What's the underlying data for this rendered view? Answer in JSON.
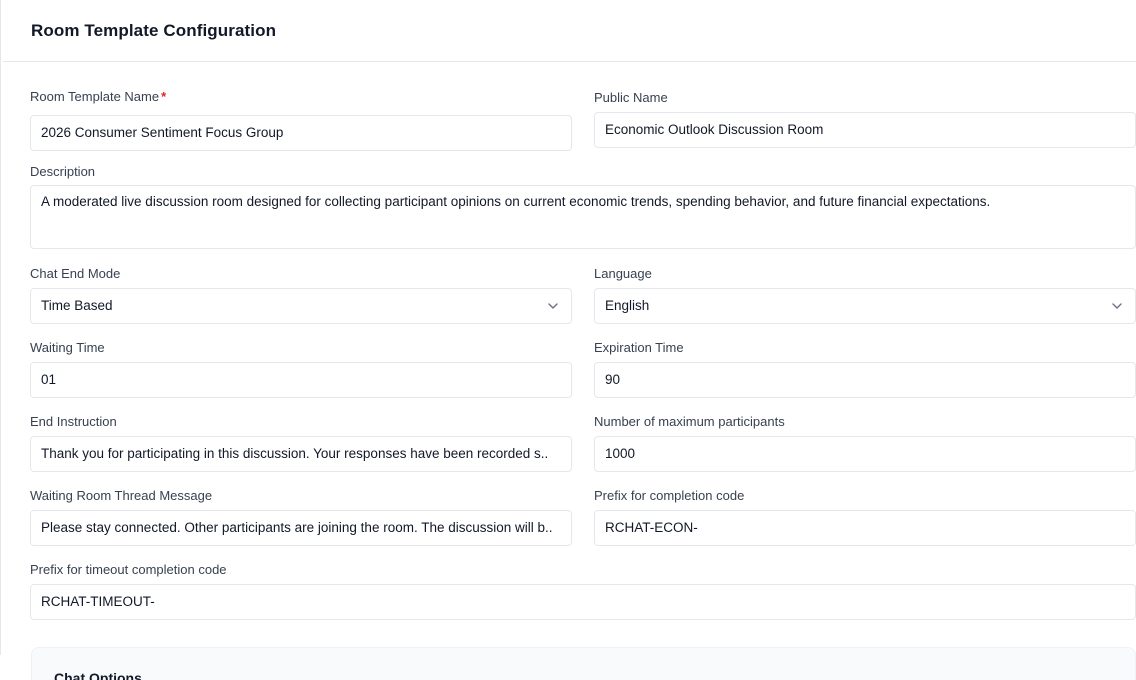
{
  "header": {
    "title": "Room Template Configuration"
  },
  "form": {
    "room_template_name": {
      "label": "Room Template Name",
      "required_mark": "*",
      "value": "2026 Consumer Sentiment Focus Group"
    },
    "public_name": {
      "label": "Public Name",
      "value": "Economic Outlook Discussion Room"
    },
    "description": {
      "label": "Description",
      "value": "A moderated live discussion room designed for collecting participant opinions on current economic trends, spending behavior, and future financial expectations."
    },
    "chat_end_mode": {
      "label": "Chat End Mode",
      "value": "Time Based",
      "icon": "chevron-down-icon"
    },
    "language": {
      "label": "Language",
      "value": "English",
      "icon": "chevron-down-icon"
    },
    "waiting_time": {
      "label": "Waiting Time",
      "value": "01"
    },
    "expiration_time": {
      "label": "Expiration Time",
      "value": "90"
    },
    "end_instruction": {
      "label": "End Instruction",
      "value": "Thank you for participating in this discussion. Your responses have been recorded s.."
    },
    "max_participants": {
      "label": "Number of maximum participants",
      "value": "1000"
    },
    "waiting_room_message": {
      "label": "Waiting Room Thread Message",
      "value": "Please stay connected. Other participants are joining the room. The discussion will b.."
    },
    "completion_prefix": {
      "label": "Prefix for completion code",
      "value": "RCHAT-ECON-"
    },
    "timeout_prefix": {
      "label": "Prefix for timeout completion code",
      "value": "RCHAT-TIMEOUT-"
    }
  },
  "chat_options": {
    "title": "Chat Options"
  },
  "colors": {
    "border": "#e5e7eb",
    "required": "#dc2626",
    "panel_bg": "#f8fafc"
  }
}
